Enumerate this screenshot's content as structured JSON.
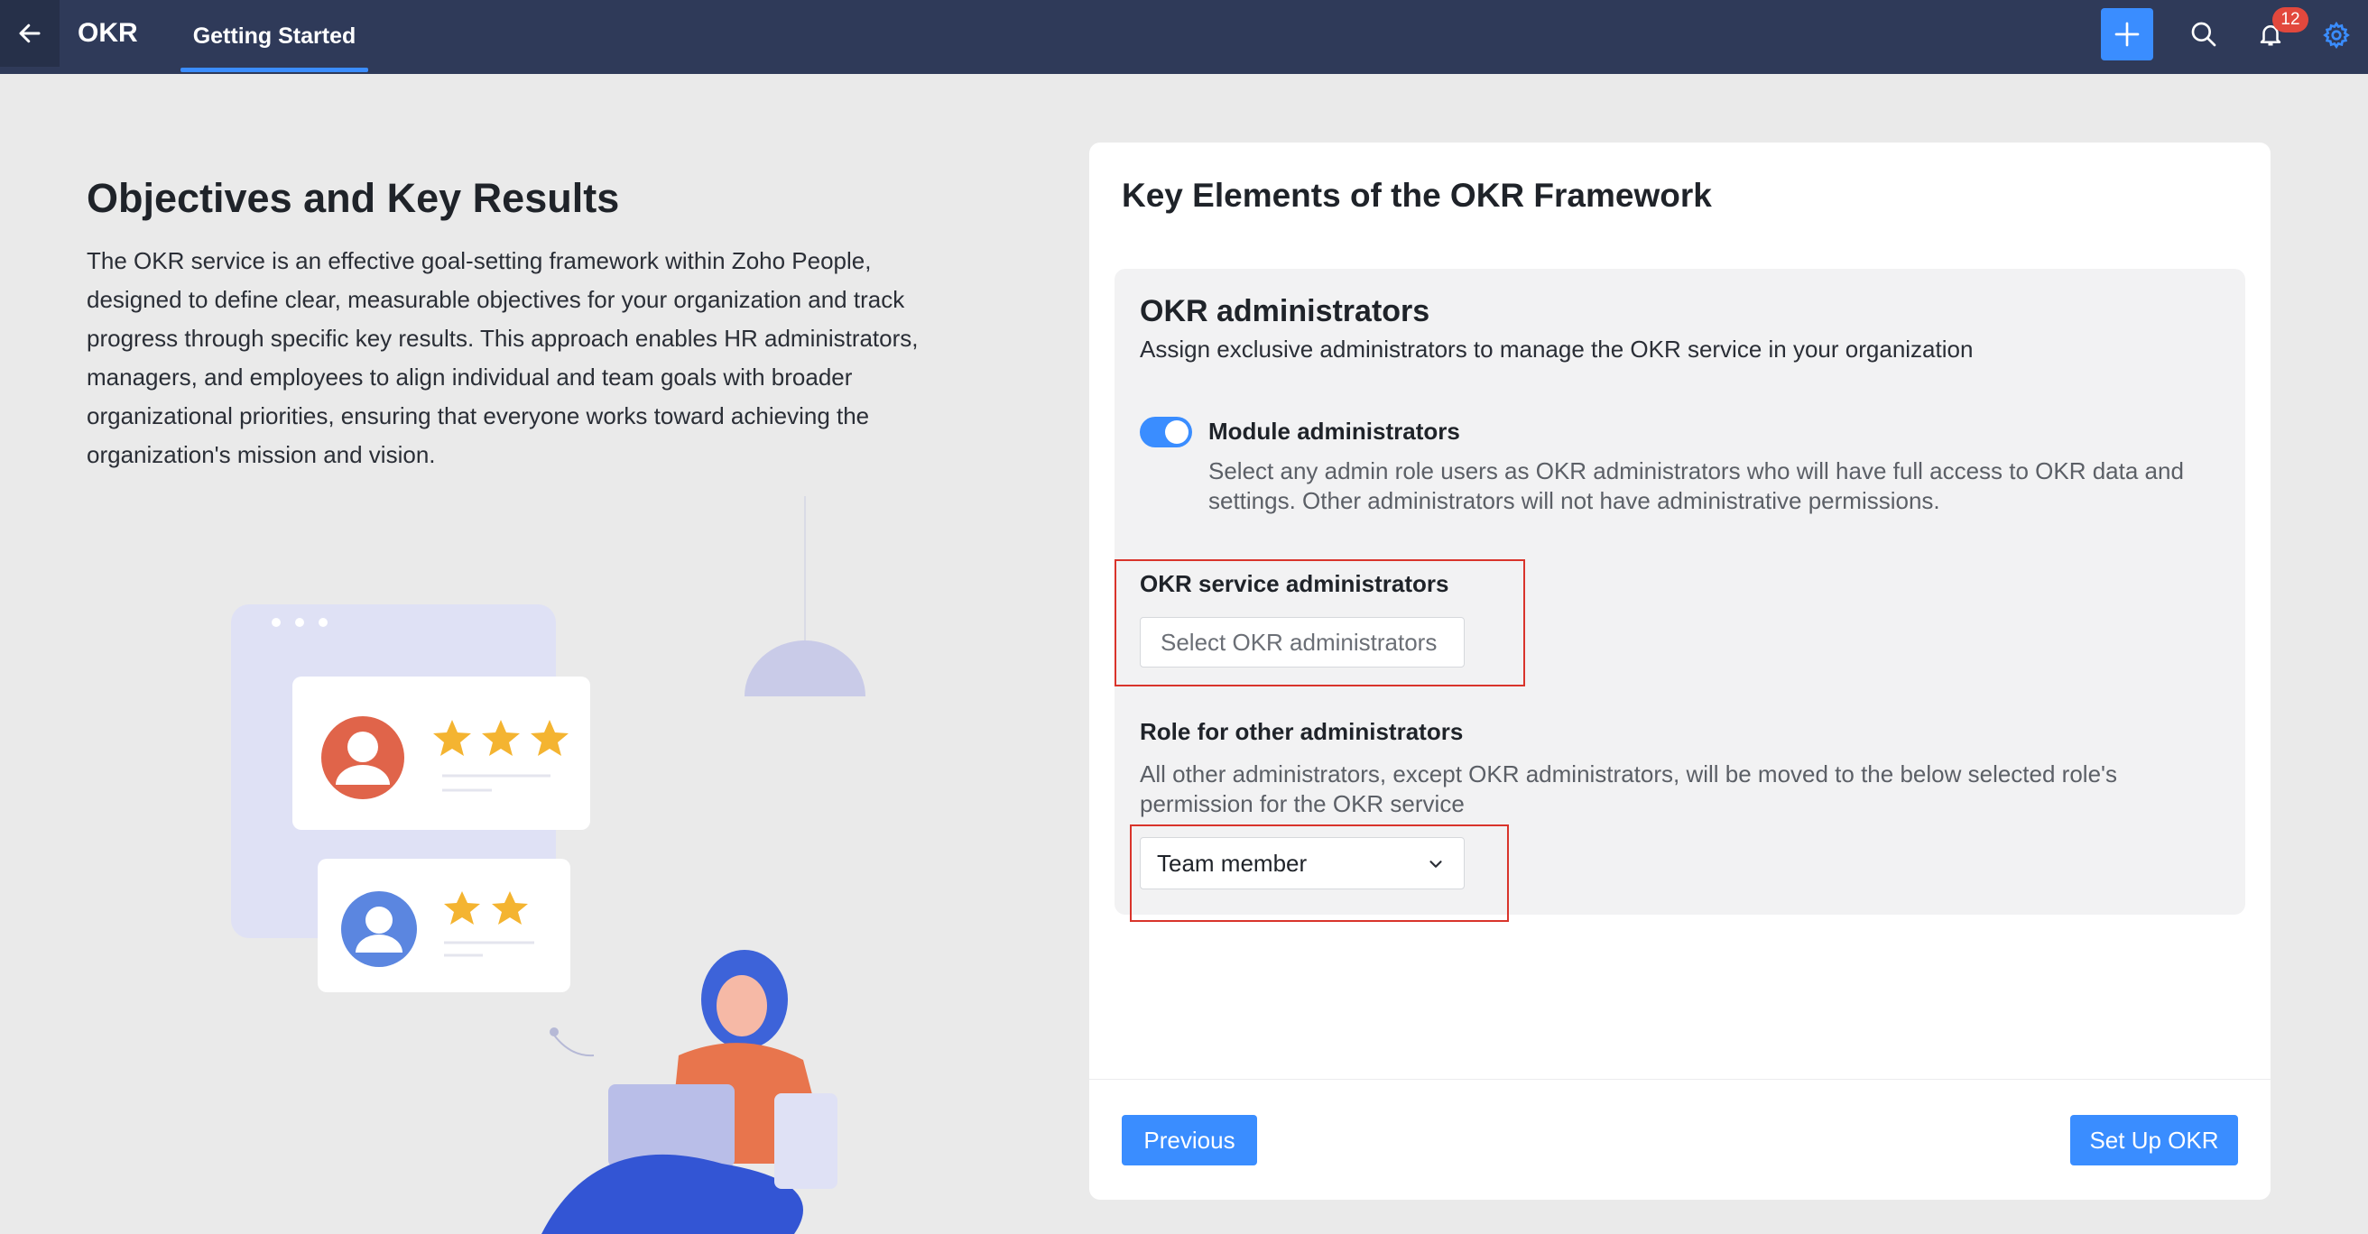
{
  "header": {
    "app_title": "OKR",
    "tab_label": "Getting Started",
    "notification_count": "12"
  },
  "intro": {
    "title": "Objectives and Key Results",
    "description": "The OKR service is an effective goal-setting framework within Zoho People, designed to define clear, measurable objectives for your organization and track progress through specific key results. This approach enables HR administrators, managers, and employees to align individual and team goals with broader organizational priorities, ensuring that everyone works toward achieving the organization's mission and vision."
  },
  "card": {
    "title": "Key Elements of the OKR Framework",
    "section": {
      "title": "OKR administrators",
      "subtitle": "Assign exclusive administrators to manage the OKR service in your organization",
      "toggle_label": "Module administrators",
      "toggle_on": true,
      "toggle_desc": "Select any admin role users as OKR administrators who will have full access to OKR data and settings. Other administrators will not have administrative permissions.",
      "service_admins_label": "OKR service administrators",
      "service_admins_placeholder": "Select OKR administrators",
      "role_label": "Role for other administrators",
      "role_desc": "All other administrators, except OKR administrators, will be moved to the below selected role's permission for the OKR service",
      "role_selected": "Team member"
    },
    "previous_label": "Previous",
    "setup_label": "Set Up OKR"
  },
  "colors": {
    "topbar": "#2f3a59",
    "accent": "#3a8dff",
    "highlight": "#d9342b",
    "badge": "#e2483d"
  }
}
